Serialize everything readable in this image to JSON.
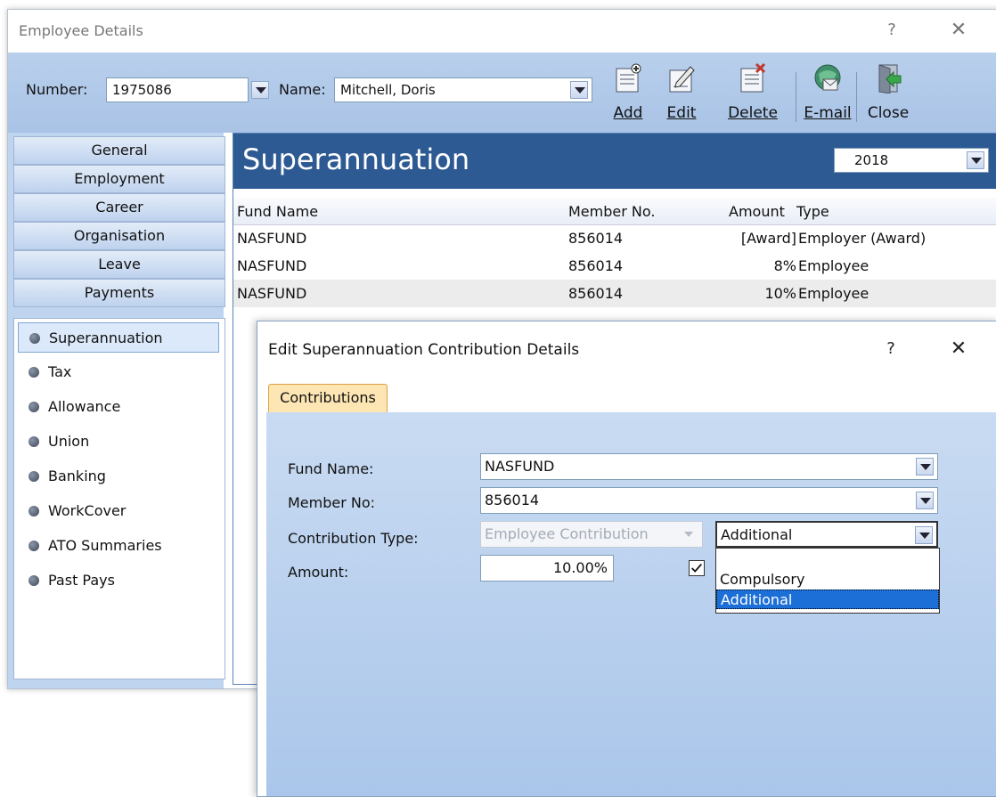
{
  "window": {
    "title": "Employee Details",
    "help": "?",
    "close": "✕"
  },
  "toolbar": {
    "number_label": "Number:",
    "number_value": "1975086",
    "name_label": "Name:",
    "name_value": "Mitchell, Doris",
    "buttons": [
      {
        "label": "Add",
        "icon": "add-icon"
      },
      {
        "label": "Edit",
        "icon": "edit-icon"
      },
      {
        "label": "Delete",
        "icon": "delete-icon"
      },
      {
        "label": "E-mail",
        "icon": "email-icon"
      },
      {
        "label": "Close",
        "icon": "close-door-icon"
      }
    ]
  },
  "nav": {
    "tabs": [
      "General",
      "Employment",
      "Career",
      "Organisation",
      "Leave",
      "Payments"
    ],
    "items": [
      "Superannuation",
      "Tax",
      "Allowance",
      "Union",
      "Banking",
      "WorkCover",
      "ATO Summaries",
      "Past Pays"
    ],
    "selected": "Superannuation"
  },
  "section": {
    "title": "Superannuation",
    "year": "2018",
    "columns": [
      "Fund Name",
      "Member No.",
      "Amount",
      "Type"
    ],
    "rows": [
      {
        "fund": "NASFUND",
        "member": "856014",
        "amount": "[Award]",
        "type": "Employer (Award)"
      },
      {
        "fund": "NASFUND",
        "member": "856014",
        "amount": "8%",
        "type": "Employee"
      },
      {
        "fund": "NASFUND",
        "member": "856014",
        "amount": "10%",
        "type": "Employee"
      }
    ]
  },
  "dialog": {
    "title": "Edit Superannuation Contribution Details",
    "help": "?",
    "close": "✕",
    "tab": "Contributions",
    "fund_label": "Fund Name:",
    "fund_value": "NASFUND",
    "member_label": "Member No:",
    "member_value": "856014",
    "contrib_label": "Contribution Type:",
    "contrib_value": "Employee Contribution",
    "contrib_sub_value": "Additional",
    "amount_label": "Amount:",
    "amount_value": "10.00%",
    "checkbox_checked": true,
    "dropdown_options": [
      "",
      "Compulsory",
      "Additional"
    ],
    "dropdown_selected": "Additional"
  },
  "colors": {
    "header_blue": "#2e5a94",
    "toolbar": "#b9d0ec",
    "selected": "#1c6fd6",
    "tab": "#fde5b4"
  }
}
